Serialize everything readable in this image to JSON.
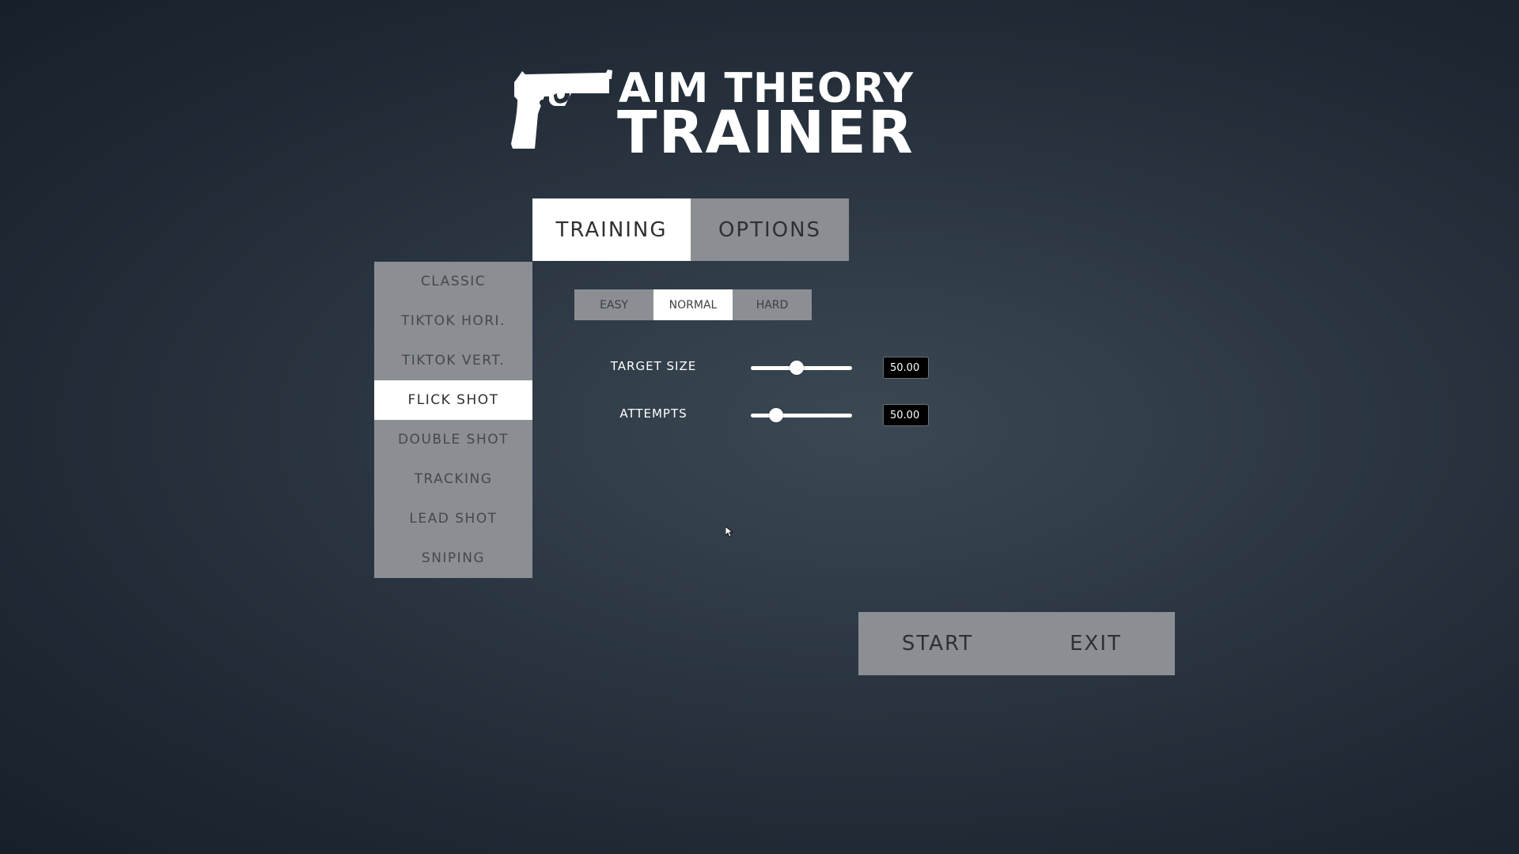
{
  "logo": {
    "line1": "AIM THEORY",
    "line2": "TRAINER",
    "icon": "pistol-icon"
  },
  "tabs": [
    {
      "label": "TRAINING",
      "active": true
    },
    {
      "label": "OPTIONS",
      "active": false
    }
  ],
  "modes": [
    {
      "label": "CLASSIC",
      "active": false
    },
    {
      "label": "TIKTOK HORI.",
      "active": false
    },
    {
      "label": "TIKTOK VERT.",
      "active": false
    },
    {
      "label": "FLICK SHOT",
      "active": true
    },
    {
      "label": "DOUBLE SHOT",
      "active": false
    },
    {
      "label": "TRACKING",
      "active": false
    },
    {
      "label": "LEAD SHOT",
      "active": false
    },
    {
      "label": "SNIPING",
      "active": false
    }
  ],
  "difficulty": [
    {
      "label": "EASY",
      "active": false
    },
    {
      "label": "NORMAL",
      "active": true
    },
    {
      "label": "HARD",
      "active": false
    }
  ],
  "settings": {
    "target_size": {
      "label": "TARGET SIZE",
      "value": "50.00",
      "slider_fraction": 0.45
    },
    "attempts": {
      "label": "ATTEMPTS",
      "value": "50.00",
      "slider_fraction": 0.25
    }
  },
  "actions": {
    "start_label": "START",
    "exit_label": "EXIT"
  },
  "colors": {
    "active_bg": "#ffffff",
    "inactive_bg": "#8b8f93",
    "text_dark": "#2e3033"
  }
}
